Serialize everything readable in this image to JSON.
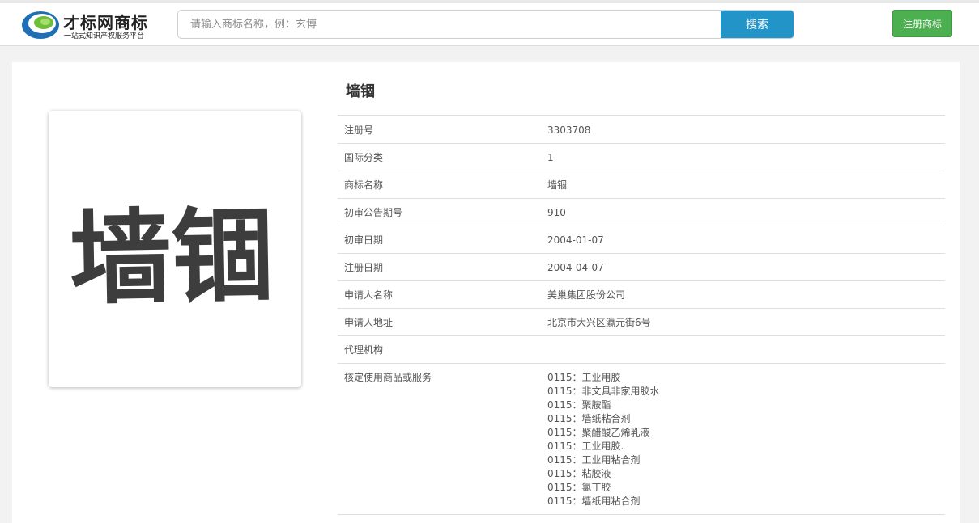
{
  "header": {
    "logo": {
      "title": "才标网商标",
      "subtitle": "一站式知识产权服务平台"
    },
    "search": {
      "placeholder": "请输入商标名称，例：玄博",
      "button_label": "搜索"
    },
    "register_label": "注册商标"
  },
  "trademark": {
    "name": "墙锢",
    "image_text": "墙锢",
    "fields": [
      {
        "label": "注册号",
        "value": "3303708"
      },
      {
        "label": "国际分类",
        "value": "1"
      },
      {
        "label": "商标名称",
        "value": "墙锢"
      },
      {
        "label": "初审公告期号",
        "value": "910"
      },
      {
        "label": "初审日期",
        "value": "2004-01-07"
      },
      {
        "label": "注册日期",
        "value": "2004-04-07"
      },
      {
        "label": "申请人名称",
        "value": "美巢集团股份公司"
      },
      {
        "label": "申请人地址",
        "value": "北京市大兴区瀛元街6号"
      },
      {
        "label": "代理机构",
        "value": ""
      }
    ],
    "services_label": "核定使用商品或服务",
    "services": [
      "0115：工业用胶",
      "0115：非文具非家用胶水",
      "0115：聚胺酯",
      "0115：墙纸粘合剂",
      "0115：聚醋酸乙烯乳液",
      "0115：工业用胶.",
      "0115：工业用粘合剂",
      "0115：粘胶液",
      "0115：氯丁胶",
      "0115：墙纸用粘合剂"
    ]
  },
  "colors": {
    "search_button": "#2394c8",
    "register_button": "#4caf50",
    "logo_blue": "#1f6fb5",
    "logo_green": "#6fbf3a"
  }
}
